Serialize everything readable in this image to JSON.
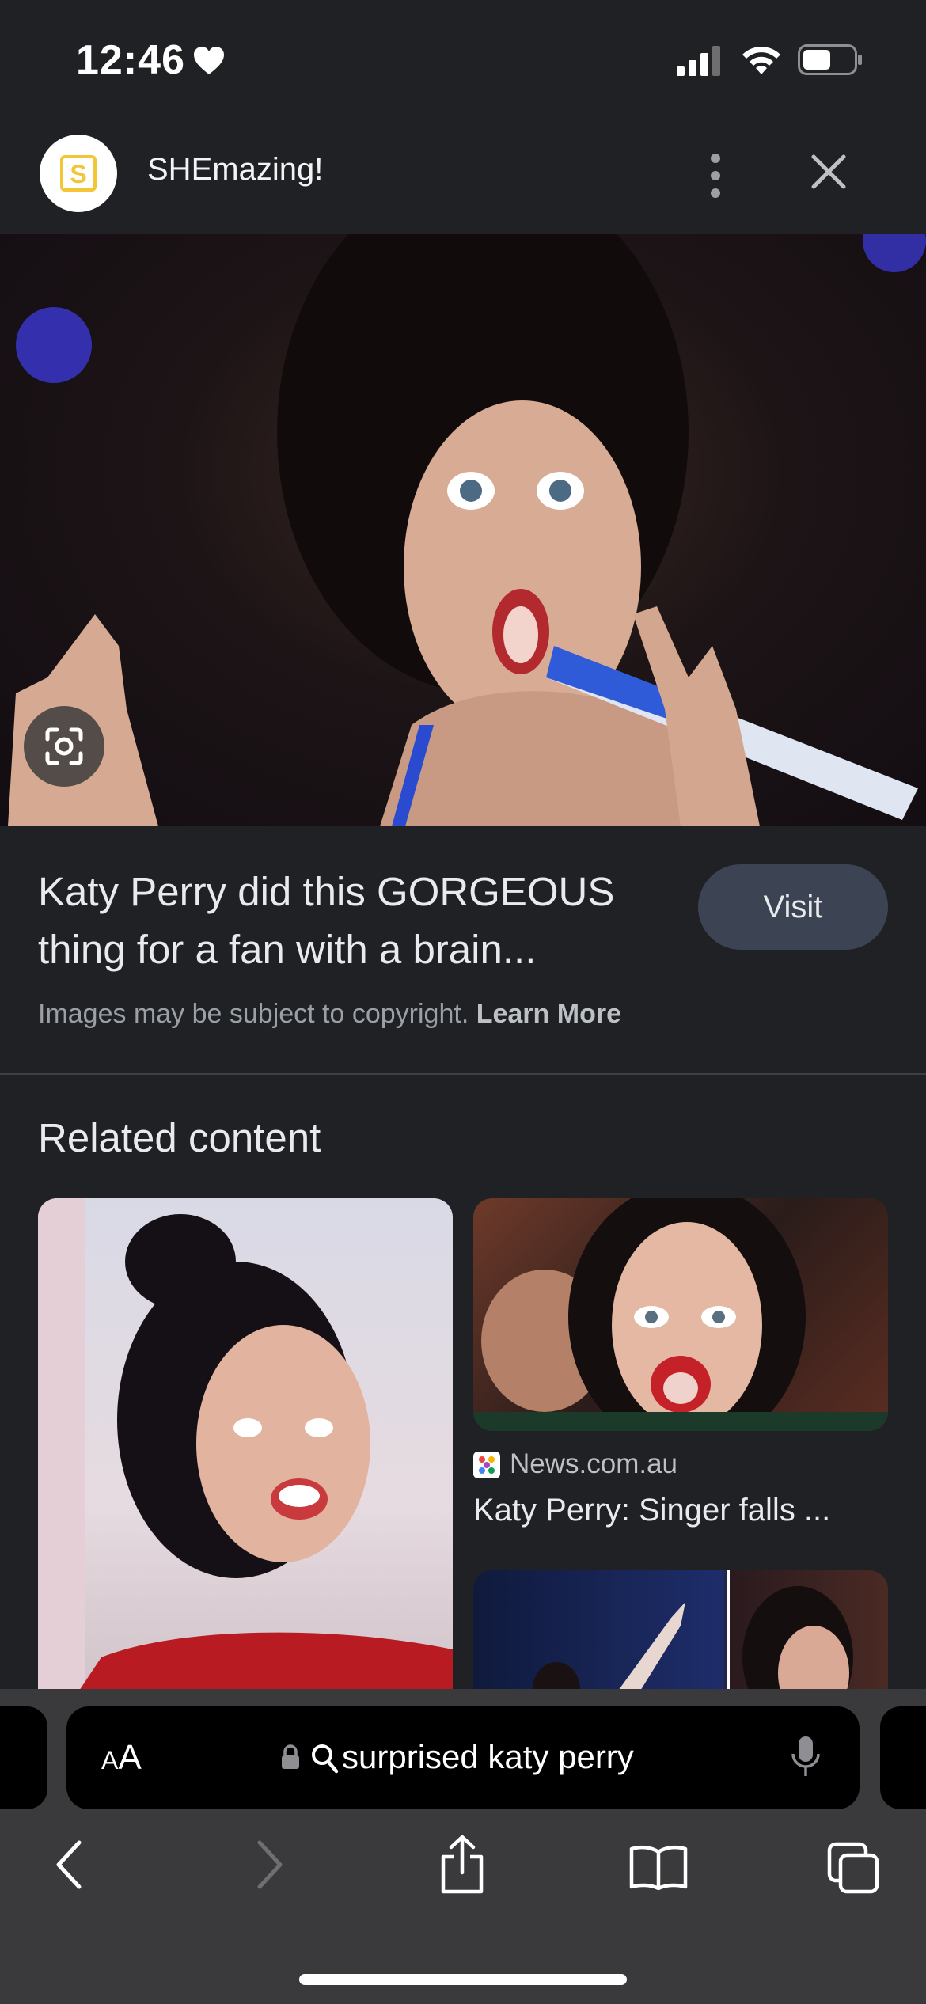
{
  "status_bar": {
    "time": "12:46"
  },
  "header": {
    "site_name": "SHEmazing!",
    "logo_letter": "S"
  },
  "result": {
    "title": "Katy Perry did this GORGEOUS thing for a fan with a brain...",
    "visit_label": "Visit",
    "copyright_text": "Images may be subject to copyright.",
    "learn_more": "Learn More"
  },
  "related": {
    "heading": "Related content",
    "cards": [
      {
        "source": "News.com.au",
        "title": "Katy Perry: Singer falls ..."
      }
    ]
  },
  "browser": {
    "text_size_label_small": "A",
    "text_size_label_large": "A",
    "search_query": "surprised katy perry"
  },
  "colors": {
    "background": "#202124",
    "visit_button": "#3c4454",
    "logo_accent": "#f3c638"
  }
}
